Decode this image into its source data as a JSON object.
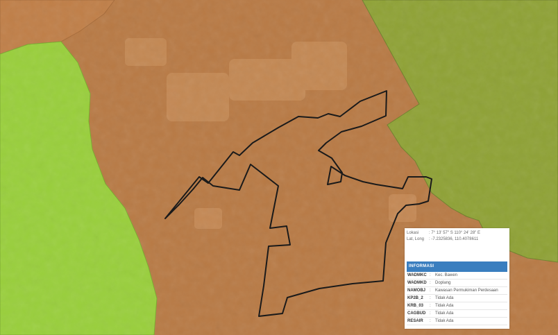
{
  "map": {
    "colors": {
      "residential": "#b87a45",
      "forest": "#8fa236",
      "agriculture": "#99cf3c",
      "boundary": "#1a1a1a"
    }
  },
  "info": {
    "location_label": "Lokasi",
    "location_value": ": 7° 13' 57\" S 110° 24' 28\" E",
    "latlong_label": "Lat, Long",
    "latlong_value": ": -7.2325836, 110.4078611",
    "header": "INFORMASI",
    "rows": [
      {
        "key": "WADMKC",
        "value": "Kec. Bawen"
      },
      {
        "key": "WADMKD",
        "value": "Doplang"
      },
      {
        "key": "NAMOBJ",
        "value": "Kawasan Permukiman Perdesaan"
      },
      {
        "key": "KP2B_2",
        "value": "Tidak Ada"
      },
      {
        "key": "KRB_03",
        "value": "Tidak Ada"
      },
      {
        "key": "CAGBUD",
        "value": "Tidak Ada"
      },
      {
        "key": "RESAIR",
        "value": "Tidak Ada"
      }
    ]
  }
}
